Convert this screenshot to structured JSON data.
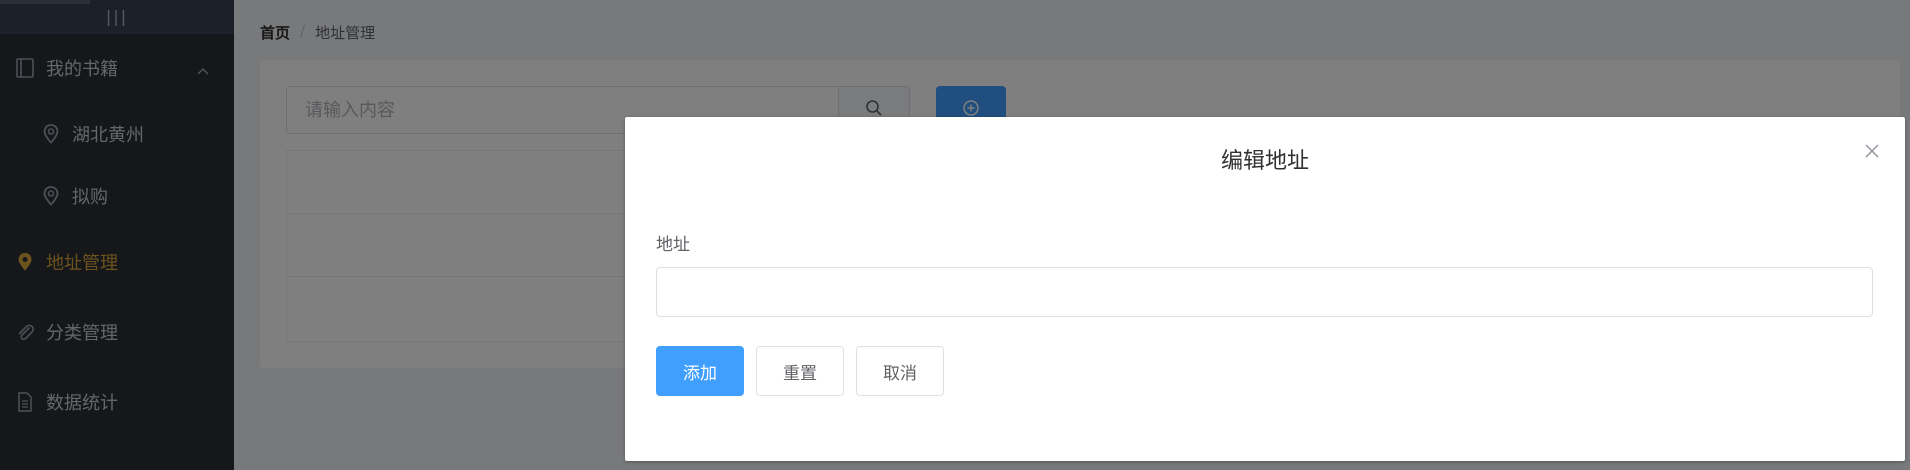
{
  "sidebar": {
    "collapse_icon": "|||",
    "menu": {
      "books": {
        "label": "我的书籍",
        "icon": "book-icon"
      },
      "sub_items": [
        {
          "label": "湖北黄州",
          "icon": "location-icon"
        },
        {
          "label": "拟购",
          "icon": "location-icon"
        }
      ],
      "address": {
        "label": "地址管理",
        "icon": "location-filled-icon"
      },
      "category": {
        "label": "分类管理",
        "icon": "paperclip-icon"
      },
      "stats": {
        "label": "数据统计",
        "icon": "document-icon"
      }
    },
    "active_color": "#d9a73a"
  },
  "breadcrumb": {
    "home": "首页",
    "separator": "/",
    "current": "地址管理"
  },
  "toolbar": {
    "search_placeholder": "请输入内容",
    "search_icon": "search-icon",
    "add_icon": "plus-circle-icon"
  },
  "dialog": {
    "title": "编辑地址",
    "field_label": "地址",
    "field_value": "",
    "add_label": "添加",
    "reset_label": "重置",
    "cancel_label": "取消",
    "close_icon": "close-icon"
  },
  "colors": {
    "primary": "#409eff",
    "sidebar_bg": "#2b2e37"
  }
}
